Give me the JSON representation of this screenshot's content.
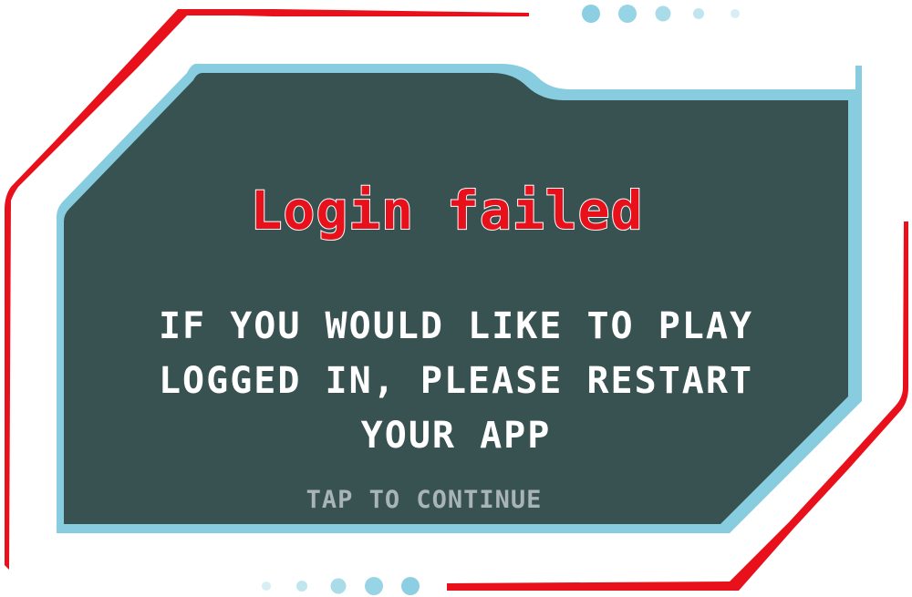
{
  "dialog": {
    "title": "Login failed",
    "message": "IF YOU WOULD LIKE TO PLAY LOGGED IN, PLEASE RESTART YOUR APP",
    "continue_label": "TAP TO CONTINUE"
  },
  "colors": {
    "accent_red": "#e8101a",
    "frame_blue": "#87ccdf",
    "panel_fill": "#385251",
    "message_text": "#ffffff",
    "continue_text": "#a8b4b6",
    "dot_blue": "#8ccfe2"
  },
  "icons": {
    "top_dots": "dots-indicator-icon",
    "bottom_dots": "dots-indicator-icon"
  }
}
